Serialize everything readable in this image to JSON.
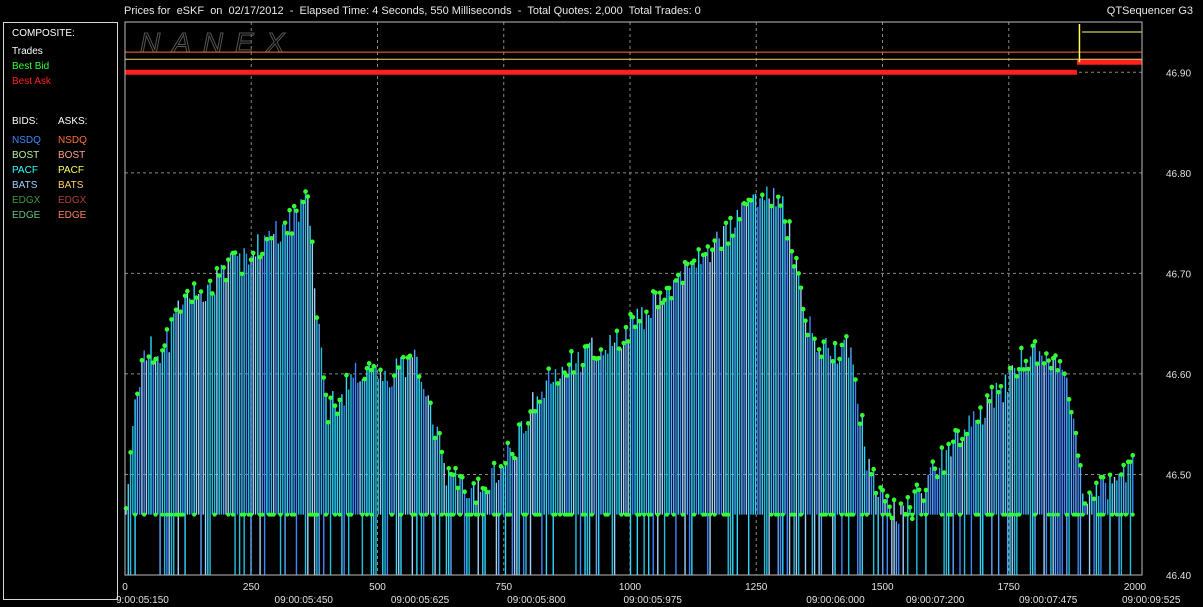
{
  "header": {
    "title": "Prices for  eSKF  on  02/17/2012  -  Elapsed Time: 4 Seconds, 550 Milliseconds  -  Total Quotes: 2,000  Total Trades: 0",
    "app_name": "QTSequencer G3",
    "watermark": "NANEX"
  },
  "legend": {
    "composite_label": "COMPOSITE:",
    "composite": [
      {
        "label": "Trades",
        "color": "#ffffff"
      },
      {
        "label": "Best Bid",
        "color": "#33ff33"
      },
      {
        "label": "Best Ask",
        "color": "#ff2020"
      }
    ],
    "bids_label": "BIDS:",
    "asks_label": "ASKS:",
    "bids": [
      {
        "label": "NSDQ",
        "color": "#3f86ff"
      },
      {
        "label": "BOST",
        "color": "#b4f0a0"
      },
      {
        "label": "PACF",
        "color": "#30ffff"
      },
      {
        "label": "BATS",
        "color": "#9fd2ff"
      },
      {
        "label": "EDGX",
        "color": "#3b9c3b"
      },
      {
        "label": "EDGE",
        "color": "#60c080"
      }
    ],
    "asks": [
      {
        "label": "NSDQ",
        "color": "#ff7030"
      },
      {
        "label": "BOST",
        "color": "#ff9f8f"
      },
      {
        "label": "PACF",
        "color": "#ffff60"
      },
      {
        "label": "BATS",
        "color": "#ffd070"
      },
      {
        "label": "EDGX",
        "color": "#b04040"
      },
      {
        "label": "EDGE",
        "color": "#ff8060"
      }
    ]
  },
  "chart_data": {
    "type": "line",
    "x_range": [
      0,
      2000
    ],
    "y_range": [
      46.4,
      46.95
    ],
    "y_ticks": [
      "46.40",
      "46.50",
      "46.60",
      "46.70",
      "46.80",
      "46.90"
    ],
    "x_ticks": [
      "0",
      "250",
      "500",
      "750",
      "1000",
      "1250",
      "1500",
      "1750",
      "2000"
    ],
    "time_labels": [
      "9:00:05:150",
      "09:00:05:450",
      "09:00:05:625",
      "09:00:05:800",
      "09:00:05:975",
      "09:00:06:000",
      "09:00:07:200",
      "09:00:07:475",
      "09:00:09:525"
    ],
    "grid": true,
    "best_ask": [
      [
        0,
        46.9
      ],
      [
        1880,
        46.9
      ],
      [
        1890,
        46.91
      ],
      [
        2000,
        46.91
      ]
    ],
    "best_bid_envelope": [
      [
        0,
        46.47
      ],
      [
        20,
        46.58
      ],
      [
        40,
        46.64
      ],
      [
        80,
        46.64
      ],
      [
        100,
        46.67
      ],
      [
        130,
        46.69
      ],
      [
        160,
        46.7
      ],
      [
        200,
        46.72
      ],
      [
        240,
        46.73
      ],
      [
        280,
        46.75
      ],
      [
        320,
        46.76
      ],
      [
        360,
        46.79
      ],
      [
        400,
        46.58
      ],
      [
        440,
        46.6
      ],
      [
        470,
        46.62
      ],
      [
        500,
        46.61
      ],
      [
        540,
        46.62
      ],
      [
        580,
        46.63
      ],
      [
        640,
        46.51
      ],
      [
        700,
        46.5
      ],
      [
        740,
        46.52
      ],
      [
        780,
        46.55
      ],
      [
        820,
        46.6
      ],
      [
        860,
        46.62
      ],
      [
        900,
        46.63
      ],
      [
        940,
        46.64
      ],
      [
        980,
        46.65
      ],
      [
        1020,
        46.67
      ],
      [
        1060,
        46.69
      ],
      [
        1100,
        46.71
      ],
      [
        1140,
        46.73
      ],
      [
        1180,
        46.75
      ],
      [
        1220,
        46.77
      ],
      [
        1250,
        46.79
      ],
      [
        1300,
        46.79
      ],
      [
        1330,
        46.72
      ],
      [
        1360,
        46.65
      ],
      [
        1400,
        46.64
      ],
      [
        1440,
        46.64
      ],
      [
        1470,
        46.52
      ],
      [
        1500,
        46.49
      ],
      [
        1540,
        46.47
      ],
      [
        1580,
        46.5
      ],
      [
        1620,
        46.53
      ],
      [
        1660,
        46.56
      ],
      [
        1700,
        46.58
      ],
      [
        1740,
        46.6
      ],
      [
        1780,
        46.63
      ],
      [
        1820,
        46.64
      ],
      [
        1860,
        46.62
      ],
      [
        1900,
        46.5
      ],
      [
        1940,
        46.5
      ],
      [
        1970,
        46.51
      ],
      [
        2000,
        46.53
      ]
    ],
    "floor_level": 46.46
  }
}
